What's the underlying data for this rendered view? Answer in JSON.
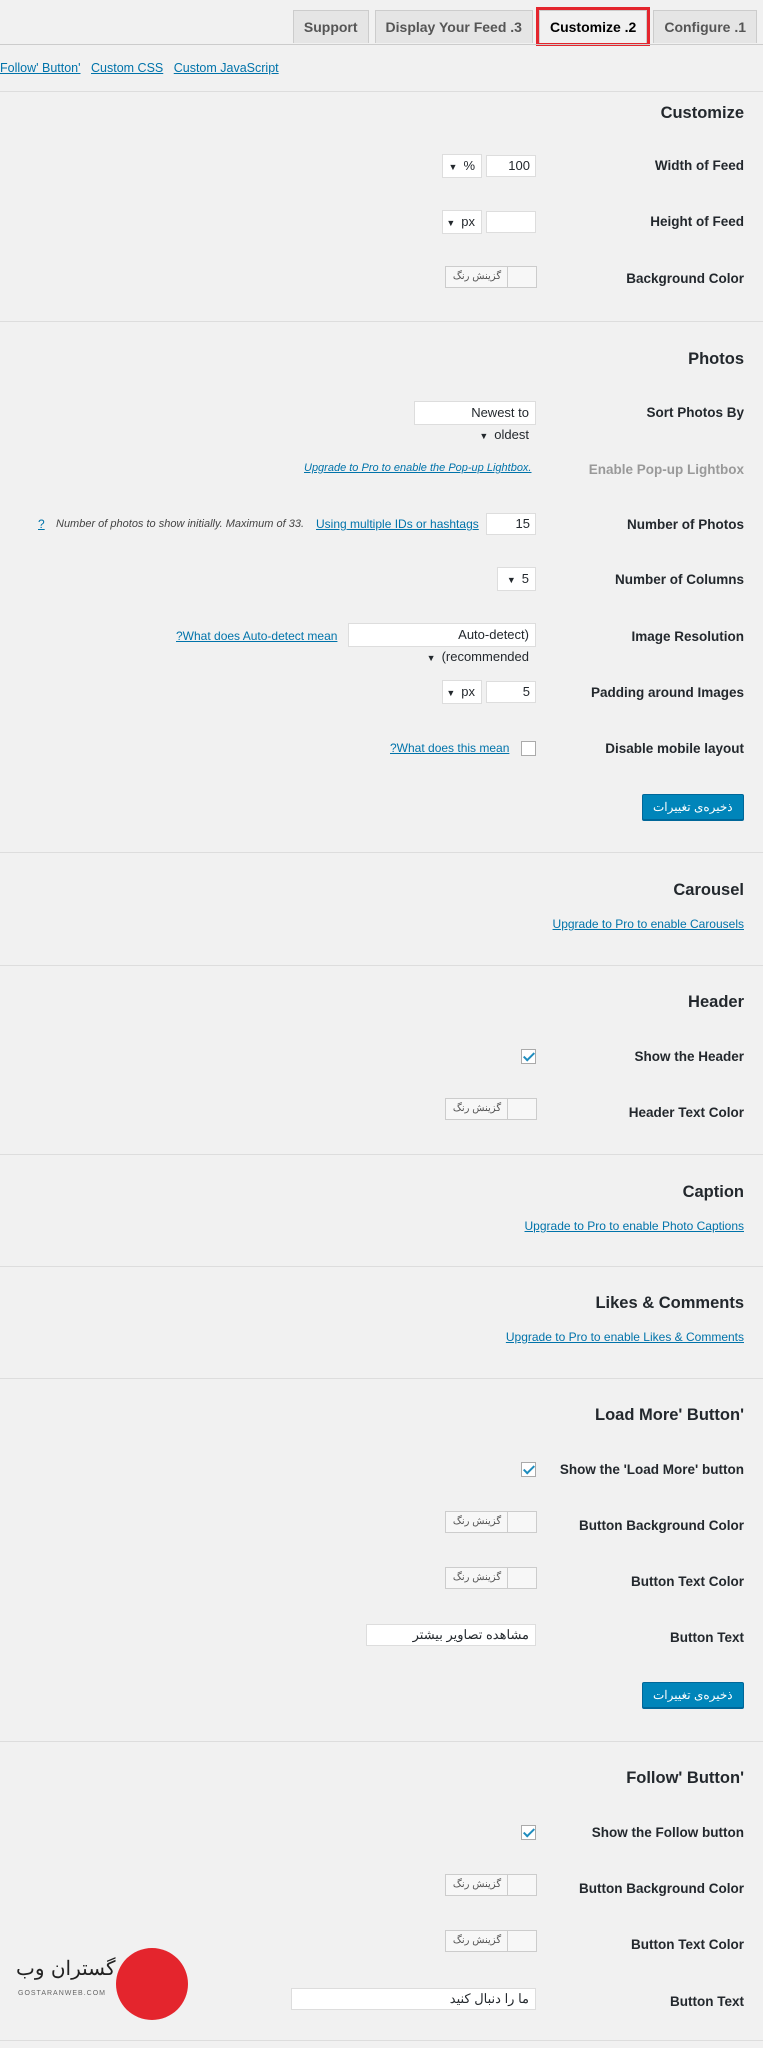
{
  "tabs": [
    {
      "label": "Configure .1"
    },
    {
      "label": "Customize .2",
      "active": true
    },
    {
      "label": "Display Your Feed .3"
    },
    {
      "label": "Support"
    }
  ],
  "quicklinks": [
    "Follow' Button'",
    "Custom CSS",
    "Custom JavaScript"
  ],
  "customize": {
    "title": "Customize",
    "width": {
      "label": "Width of Feed",
      "value": "100",
      "unit": "%"
    },
    "height": {
      "label": "Height of Feed",
      "value": "",
      "unit": "px"
    },
    "bg": {
      "label": "Background Color",
      "picker": "گزینش رنگ"
    }
  },
  "photos": {
    "title": "Photos",
    "sort": {
      "label": "Sort Photos By",
      "value": "Newest to oldest"
    },
    "lightbox": {
      "label": "Enable Pop-up Lightbox",
      "upgrade": "Upgrade to Pro to enable the Pop-up Lightbox."
    },
    "num": {
      "label": "Number of Photos",
      "value": "15",
      "link": "Using multiple IDs or hashtags",
      "note": "Number of photos to show initially. Maximum of 33.",
      "help": "?"
    },
    "cols": {
      "label": "Number of Columns",
      "value": "5"
    },
    "res": {
      "label": "Image Resolution",
      "value": "(Auto-detect (recommended",
      "link": "?What does Auto-detect mean"
    },
    "pad": {
      "label": "Padding around Images",
      "value": "5",
      "unit": "px"
    },
    "mobile": {
      "label": "Disable mobile layout",
      "link": "?What does this mean"
    },
    "save": "ذخیره‌ی تغییرات"
  },
  "carousel": {
    "title": "Carousel",
    "upgrade": "Upgrade to Pro to enable Carousels"
  },
  "header": {
    "title": "Header",
    "show": "Show the Header",
    "color": "Header Text Color",
    "picker": "گزینش رنگ"
  },
  "caption": {
    "title": "Caption",
    "upgrade": "Upgrade to Pro to enable Photo Captions"
  },
  "likes": {
    "title": "Likes & Comments",
    "upgrade": "Upgrade to Pro to enable Likes & Comments"
  },
  "loadmore": {
    "title": "Load More' Button'",
    "show": "Show the 'Load More' button",
    "bg": "Button Background Color",
    "text_color": "Button Text Color",
    "text_label": "Button Text",
    "text_value": "مشاهده تصاویر بیشتر",
    "picker": "گزینش رنگ",
    "save": "ذخیره‌ی تغییرات"
  },
  "follow": {
    "title": "Follow' Button'",
    "show": "Show the Follow button",
    "bg": "Button Background Color",
    "text_color": "Button Text Color",
    "text_label": "Button Text",
    "text_value": "ما را دنبال کنید",
    "picker": "گزینش رنگ"
  },
  "logo": {
    "name": "گستران وب",
    "en": "GOSTARANWEB.COM"
  },
  "colors": {
    "accent": "#0085ba",
    "link": "#0073aa",
    "highlight": "#e4252d"
  }
}
